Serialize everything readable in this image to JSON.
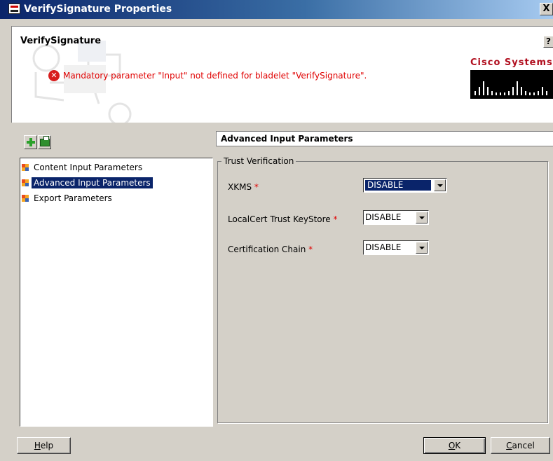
{
  "window": {
    "title": "VerifySignature Properties",
    "close_glyph": "X"
  },
  "header": {
    "component_name": "VerifySignature",
    "help_glyph": "?",
    "error_message": "Mandatory parameter \"Input\" not defined for bladelet \"VerifySignature\".",
    "error_icon_glyph": "✕",
    "logo_text": "Cisco Systems"
  },
  "tree": {
    "items": [
      {
        "label": "Content Input Parameters",
        "selected": false
      },
      {
        "label": "Advanced Input Parameters",
        "selected": true
      },
      {
        "label": "Export Parameters",
        "selected": false
      }
    ]
  },
  "panel": {
    "section_title": "Advanced Input Parameters",
    "group_title": "Trust Verification",
    "required_mark": "*",
    "fields": [
      {
        "label": "XKMS",
        "value": "DISABLE"
      },
      {
        "label": "LocalCert Trust KeyStore",
        "value": "DISABLE"
      },
      {
        "label": "Certification Chain",
        "value": "DISABLE"
      }
    ]
  },
  "buttons": {
    "help_first": "H",
    "help_rest": "elp",
    "ok_first": "O",
    "ok_rest": "K",
    "cancel_first": "C",
    "cancel_rest": "ancel"
  },
  "colors": {
    "error": "#e00000",
    "selection": "#0a246a",
    "brand": "#b10f1f"
  }
}
